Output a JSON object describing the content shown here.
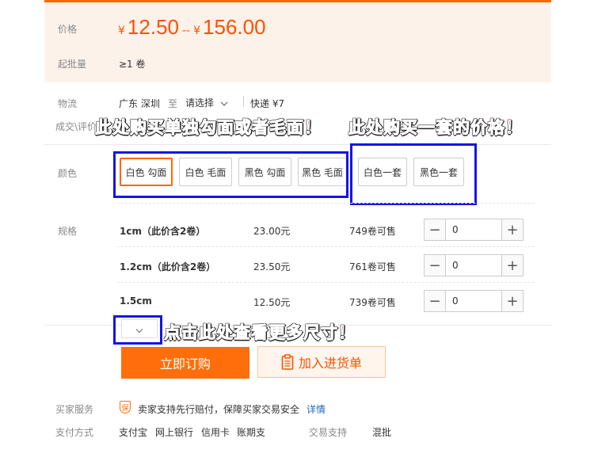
{
  "price": {
    "label": "价格",
    "currency": "¥",
    "low": "12.50",
    "separator": "--",
    "high": "156.00",
    "moq_label": "起批量",
    "moq_value": "≥1 卷"
  },
  "logistics": {
    "label": "物流",
    "from": "广东 深圳",
    "to_word": "至",
    "destination": "请选择",
    "shipping": "快递 ¥7"
  },
  "deals": {
    "label": "成交\\评价"
  },
  "colors": {
    "label": "颜色",
    "options": [
      "白色 勾面",
      "白色 毛面",
      "黑色 勾面",
      "黑色 毛面",
      "白色一套",
      "黑色一套"
    ],
    "selected_index": 0
  },
  "specs": {
    "label": "规格",
    "rows": [
      {
        "size": "1cm（此价含2卷）",
        "price": "23.00元",
        "stock": "749卷可售",
        "qty": "0"
      },
      {
        "size": "1.2cm（此价含2卷）",
        "price": "23.50元",
        "stock": "761卷可售",
        "qty": "0"
      },
      {
        "size": "1.5cm",
        "price": "12.50元",
        "stock": "739卷可售",
        "qty": "0"
      }
    ],
    "minus": "−",
    "plus": "+"
  },
  "annotations": {
    "single": "此处购买单独勾面或者毛面！",
    "set": "此处购买一套的价格！",
    "more": "点击此处查看更多尺寸！"
  },
  "actions": {
    "order": "立即订购",
    "cart": "加入进货单"
  },
  "services": {
    "label": "买家服务",
    "badge": "保",
    "text": "卖家支持先行赔付，保障买家交易安全",
    "link": "详情"
  },
  "payment": {
    "label": "支付方式",
    "methods": [
      "支付宝",
      "网上银行",
      "信用卡",
      "账期支"
    ],
    "trade_label": "交易支持",
    "trade_value": "混批"
  },
  "colors_theme": {
    "accent": "#ff5000",
    "annotation_box": "#1414e6",
    "annotation_text": "#ff0000"
  }
}
